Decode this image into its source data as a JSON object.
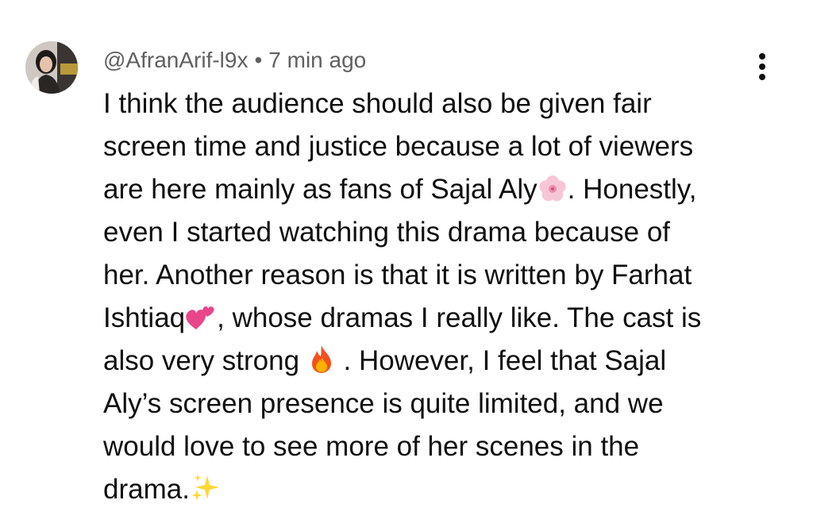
{
  "comment": {
    "author": "@AfranArif-l9x",
    "separator": "•",
    "timestamp": "7 min ago",
    "lines": [
      {
        "text": "I think the audience should also be given fair"
      },
      {
        "text": "screen time and justice because a lot of viewers"
      },
      {
        "text": "are here mainly as fans of Sajal Aly",
        "after": ". Honestly,"
      },
      {
        "text": "even I started watching this drama because of"
      },
      {
        "text": "her. Another reason is that it is written by Farhat"
      },
      {
        "text": "Ishtiaq",
        "after": ", whose dramas I really like. The cast is"
      },
      {
        "text": "also very strong ",
        "after": " . However, I feel that Sajal"
      },
      {
        "text": "Aly’s screen presence is quite limited, and we"
      },
      {
        "text": "would love to see more of her scenes in the"
      },
      {
        "text": "drama."
      }
    ],
    "emoji_icons": [
      "cherry-blossom-icon",
      "two-hearts-icon",
      "fire-icon",
      "sparkles-icon"
    ],
    "menu_icon": "more-vertical-icon"
  },
  "colors": {
    "meta_text": "#606060",
    "body_text": "#0f0f0f",
    "background": "#ffffff"
  }
}
